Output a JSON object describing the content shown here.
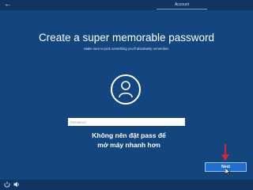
{
  "header": {
    "step_label": "Account"
  },
  "main": {
    "title": "Create a super memorable password",
    "subtitle": "Make sure to pick something you'll absolutely remember.",
    "password_placeholder": "Password",
    "annotation_line1": "Không nên đặt pass để",
    "annotation_line2": "mở máy nhanh hơn"
  },
  "footer": {
    "next_label": "Next"
  },
  "icons": {
    "back": "back-arrow-icon",
    "avatar": "user-avatar-icon",
    "ease_of_access": "ease-of-access-icon",
    "volume": "volume-icon",
    "annotation_arrow": "red-arrow-icon",
    "cursor": "cursor-icon"
  },
  "colors": {
    "background": "#13457f",
    "bar": "#0f3560",
    "button": "#1e6fd0",
    "arrow": "#e0262a"
  }
}
